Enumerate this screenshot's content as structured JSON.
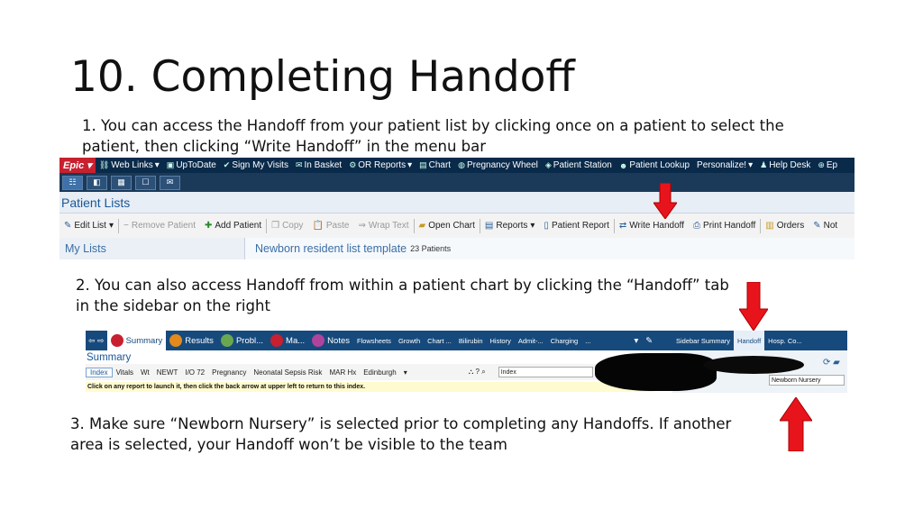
{
  "slide": {
    "title": "10. Completing Handoff",
    "step1": "1. You can access the Handoff from your patient list by clicking once on a patient to select the patient, then clicking “Write Handoff” in the menu bar",
    "step2": "2. You can also access Handoff from within a patient chart by clicking the “Handoff” tab in the sidebar on the right",
    "step3": "3. Make sure “Newborn Nursery” is selected prior to completing any Handoffs. If another area is selected, your Handoff won’t be visible to the team"
  },
  "shot1": {
    "epic": "Epic",
    "topbar": [
      "Web Links",
      "UpToDate",
      "Sign My Visits",
      "In Basket",
      "OR Reports",
      "Chart",
      "Pregnancy Wheel",
      "Patient Station",
      "Patient Lookup",
      "Personalize!",
      "Help Desk",
      "Ep"
    ],
    "header": "Patient Lists",
    "toolbar": [
      "Edit List",
      "Remove Patient",
      "Add Patient",
      "Copy",
      "Paste",
      "Wrap Text",
      "Open Chart",
      "Reports",
      "Patient Report",
      "Write Handoff",
      "Print Handoff",
      "Orders",
      "Not"
    ],
    "my_lists": "My Lists",
    "list_name": "Newborn resident list template",
    "list_count": "23 Patients"
  },
  "shot2": {
    "tabs": [
      "Summary",
      "Results",
      "Probl...",
      "Ma...",
      "Notes",
      "Flowsheets",
      "Growth",
      "Chart ...",
      "Bilirubin",
      "History",
      "Admit-...",
      "Charging",
      "..."
    ],
    "side_tabs": [
      "Sidebar Summary",
      "Handoff",
      "Hosp. Co..."
    ],
    "summary_header": "Summary",
    "summary_tabs": [
      "Index",
      "Vitals",
      "Wt",
      "NEWT",
      "I/O 72",
      "Pregnancy",
      "Neonatal Sepsis Risk",
      "MAR Hx",
      "Edinburgh"
    ],
    "search_value": "Index",
    "instruction": "Click on any report to launch it, then click the back arrow at upper left to return to this index.",
    "area_value": "Newborn Nursery"
  },
  "colors": {
    "arrow": "#e8141c",
    "epic_bar": "#0a2a4a",
    "header_blue": "#1a5796"
  }
}
